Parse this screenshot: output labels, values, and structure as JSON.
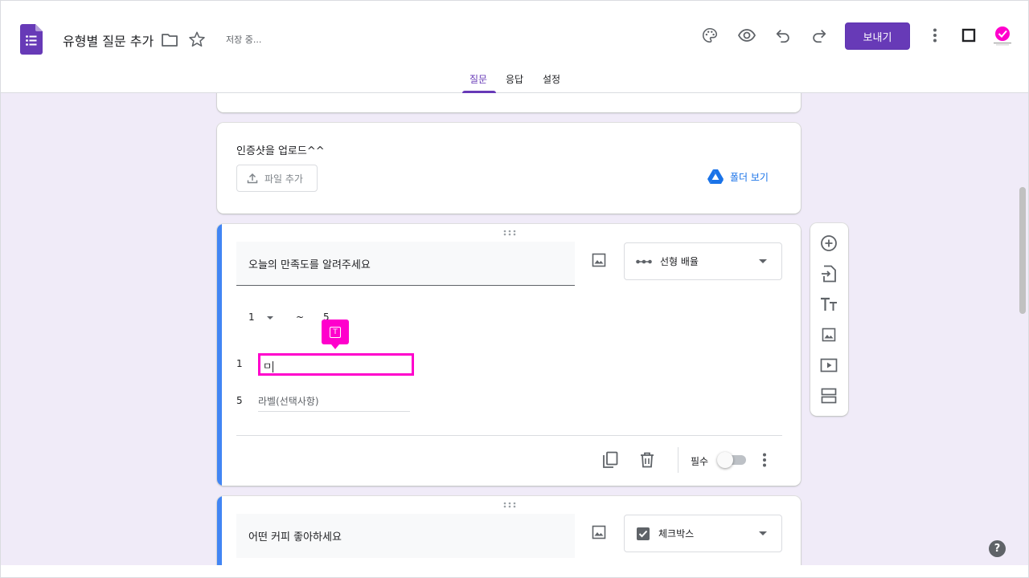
{
  "header": {
    "doc_title": "유형별 질문 추가",
    "save_status": "저장 중...",
    "send_label": "보내기",
    "icons": [
      "folder-icon",
      "star-icon",
      "palette-icon",
      "eye-icon",
      "undo-icon",
      "redo-icon",
      "more-vert-icon",
      "square-icon"
    ]
  },
  "tabs": [
    {
      "label": "질문",
      "active": true
    },
    {
      "label": "응답",
      "active": false
    },
    {
      "label": "설정",
      "active": false
    }
  ],
  "upload_question": {
    "title": "인증샷을 업로드^^",
    "add_file_label": "파일 추가",
    "folder_view_label": "폴더 보기"
  },
  "linear_scale_question": {
    "title": "오늘의 만족도를 알려주세요",
    "type_label": "선형 배율",
    "scale_min": "1",
    "scale_separator": "~",
    "scale_max": "5",
    "min_label_number": "1",
    "min_label_value": "ㅁ",
    "max_label_number": "5",
    "max_label_placeholder": "라벨(선택사항)",
    "required_label": "필수",
    "required": false
  },
  "tooltip": {
    "glyph": "T"
  },
  "next_question": {
    "title": "어떤 커피 좋아하세요",
    "type_label": "체크박스"
  },
  "help": {
    "label": "?"
  },
  "colors": {
    "accent": "#673ab7",
    "canvas": "#f0ebf8",
    "focus_bar": "#4285f4",
    "highlight": "#ff00cc",
    "link": "#1a73e8"
  }
}
